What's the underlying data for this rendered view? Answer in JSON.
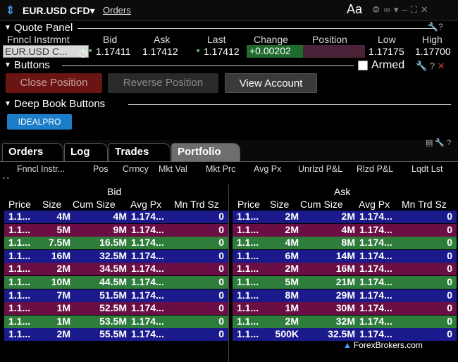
{
  "titlebar": {
    "symbol": "EUR.USD CFD▾",
    "menu": "Orders",
    "font_size_label": "Aa",
    "icons": [
      "gear-icon",
      "link-icon",
      "pin-icon",
      "minimize-icon",
      "maximize-icon",
      "close-icon"
    ]
  },
  "quote_panel": {
    "title": "Quote Panel",
    "columns": [
      "Fnncl Instrmnt",
      "Bid",
      "Ask",
      "Last",
      "Change",
      "Position",
      "Low",
      "High"
    ],
    "row": {
      "instrument": "EUR.USD C...",
      "bid": "1.17411",
      "ask": "1.17412",
      "last": "1.17412",
      "change": "+0.00202",
      "position": "",
      "low": "1.17175",
      "high": "1.17700"
    }
  },
  "buttons_panel": {
    "title": "Buttons",
    "close_position": "Close Position",
    "reverse_position": "Reverse Position",
    "view_account": "View Account",
    "armed_label": "Armed"
  },
  "deep_book_buttons": {
    "title": "Deep Book Buttons",
    "idealpro": "IDEALPRO"
  },
  "tabs": [
    "Orders",
    "Log",
    "Trades",
    "Portfolio"
  ],
  "active_tab": "Portfolio",
  "portfolio_columns": [
    "Fnncl Instr...",
    "Pos",
    "Crrncy",
    "Mkt Val",
    "Mkt Prc",
    "Avg Px",
    "Unrlzd P&L",
    "Rlzd P&L",
    "Lqdt Lst"
  ],
  "depth": {
    "bid_title": "Bid",
    "ask_title": "Ask",
    "columns": [
      "Price",
      "Size",
      "Cum Size",
      "Avg Px",
      "Mn Trd Sz"
    ],
    "row_colors": [
      "#1a1a8c",
      "#6b0e45",
      "#2e7d3a",
      "#1a1a8c",
      "#6b0e45",
      "#2e7d3a",
      "#1a1a8c",
      "#6b0e45",
      "#2e7d3a",
      "#1a1a8c"
    ],
    "bid_rows": [
      {
        "price": "1.1...",
        "size": "4M",
        "cum": "4M",
        "avg": "1.174...",
        "mn": "0"
      },
      {
        "price": "1.1...",
        "size": "5M",
        "cum": "9M",
        "avg": "1.174...",
        "mn": "0"
      },
      {
        "price": "1.1...",
        "size": "7.5M",
        "cum": "16.5M",
        "avg": "1.174...",
        "mn": "0"
      },
      {
        "price": "1.1...",
        "size": "16M",
        "cum": "32.5M",
        "avg": "1.174...",
        "mn": "0"
      },
      {
        "price": "1.1...",
        "size": "2M",
        "cum": "34.5M",
        "avg": "1.174...",
        "mn": "0"
      },
      {
        "price": "1.1...",
        "size": "10M",
        "cum": "44.5M",
        "avg": "1.174...",
        "mn": "0"
      },
      {
        "price": "1.1...",
        "size": "7M",
        "cum": "51.5M",
        "avg": "1.174...",
        "mn": "0"
      },
      {
        "price": "1.1...",
        "size": "1M",
        "cum": "52.5M",
        "avg": "1.174...",
        "mn": "0"
      },
      {
        "price": "1.1...",
        "size": "1M",
        "cum": "53.5M",
        "avg": "1.174...",
        "mn": "0"
      },
      {
        "price": "1.1...",
        "size": "2M",
        "cum": "55.5M",
        "avg": "1.174...",
        "mn": "0"
      }
    ],
    "ask_rows": [
      {
        "price": "1.1...",
        "size": "2M",
        "cum": "2M",
        "avg": "1.174...",
        "mn": "0"
      },
      {
        "price": "1.1...",
        "size": "2M",
        "cum": "4M",
        "avg": "1.174...",
        "mn": "0"
      },
      {
        "price": "1.1...",
        "size": "4M",
        "cum": "8M",
        "avg": "1.174...",
        "mn": "0"
      },
      {
        "price": "1.1...",
        "size": "6M",
        "cum": "14M",
        "avg": "1.174...",
        "mn": "0"
      },
      {
        "price": "1.1...",
        "size": "2M",
        "cum": "16M",
        "avg": "1.174...",
        "mn": "0"
      },
      {
        "price": "1.1...",
        "size": "5M",
        "cum": "21M",
        "avg": "1.174...",
        "mn": "0"
      },
      {
        "price": "1.1...",
        "size": "8M",
        "cum": "29M",
        "avg": "1.174...",
        "mn": "0"
      },
      {
        "price": "1.1...",
        "size": "1M",
        "cum": "30M",
        "avg": "1.174...",
        "mn": "0"
      },
      {
        "price": "1.1...",
        "size": "2M",
        "cum": "32M",
        "avg": "1.174...",
        "mn": "0"
      },
      {
        "price": "1.1...",
        "size": "500K",
        "cum": "32.5M",
        "avg": "1.174...",
        "mn": "0"
      }
    ]
  },
  "watermark": "ForexBrokers.com"
}
